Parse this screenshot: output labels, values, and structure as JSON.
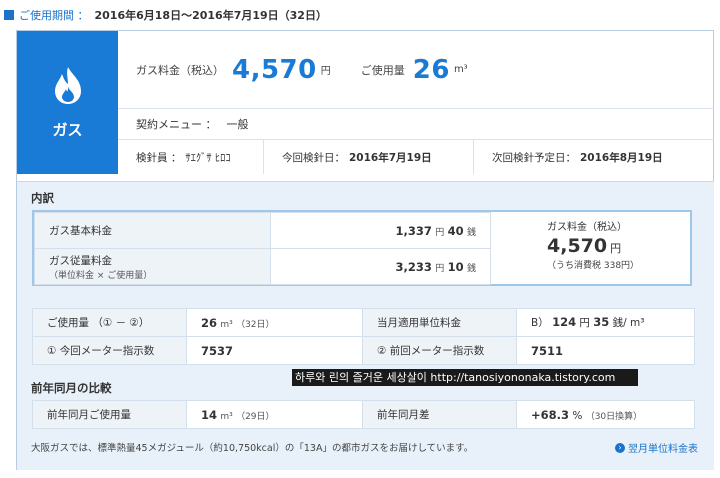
{
  "period": {
    "label": "ご使用期間 ：",
    "value": "2016年6月18日～2016年7月19日（32日）"
  },
  "tile": {
    "icon": "flame-icon",
    "label": "ガス"
  },
  "summary": {
    "fee_label": "ガス料金（税込）",
    "fee_value": "4,570",
    "fee_unit": "円",
    "usage_label": "ご使用量",
    "usage_value": "26",
    "usage_unit": "m³"
  },
  "contract": {
    "label": "契約メニュー ：",
    "value": "一般"
  },
  "meter": {
    "reader_label": "検針員 ：",
    "reader_value": "ｻｴｸﾞｻ ﾋﾛｺ",
    "current_label": "今回検針日：",
    "current_value": "2016年7月19日",
    "next_label": "次回検針予定日：",
    "next_value": "2016年8月19日"
  },
  "breakdown": {
    "title": "内訳",
    "base_label": "ガス基本料金",
    "base_yen": "1,337",
    "base_sen": "40",
    "usage_fee_label": "ガス従量料金",
    "usage_fee_sub": "（単位料金 × ご使用量）",
    "usage_yen": "3,233",
    "usage_sen": "10",
    "yen_unit": "円",
    "sen_unit": "銭",
    "total_label": "ガス料金（税込）",
    "total_value": "4,570",
    "total_unit": "円",
    "tax_note": "（うち消費税 338円）"
  },
  "usage_table": {
    "usage_label": "ご使用量 （① － ②）",
    "usage_value": "26",
    "usage_unit": "m³",
    "usage_days": "（32日）",
    "unit_price_label": "当月適用単位料金",
    "unit_price_prefix": "B）",
    "unit_price_yen": "124",
    "unit_price_sen": "35",
    "unit_price_suffix": "円",
    "unit_price_sen_suffix": "銭/ m³",
    "current_label": "① 今回メーター指示数",
    "current_value": "7537",
    "prev_label": "② 前回メーター指示数",
    "prev_value": "7511"
  },
  "comparison": {
    "title": "前年同月の比較",
    "usage_label": "前年同月ご使用量",
    "usage_value": "14",
    "usage_unit": "m³",
    "usage_days": "（29日）",
    "diff_label": "前年同月差",
    "diff_value": "+68.3",
    "diff_unit": "%",
    "diff_note": "（30日換算）"
  },
  "footer": {
    "note": "大阪ガスでは、標準熱量45メガジュール（約10,750kcal）の「13A」の都市ガスをお届けしています。",
    "link": "翌月単位料金表"
  },
  "watermark": "하루와 린의 즐거운 세상살이 http://tanosiyononaka.tistory.com",
  "colors": {
    "accent": "#1a7bd6",
    "panel": "#e8f1fa"
  }
}
